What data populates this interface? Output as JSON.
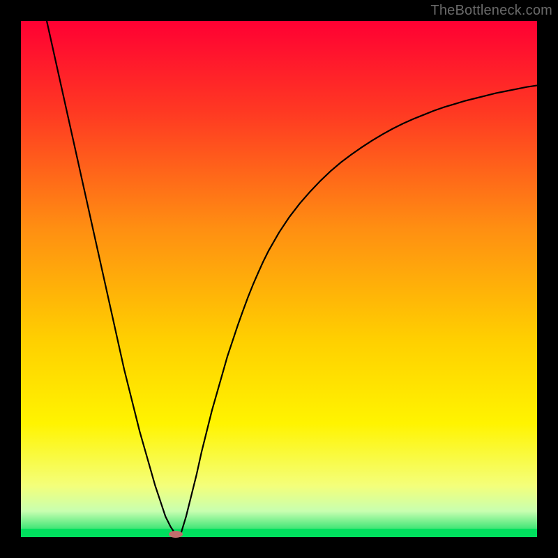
{
  "watermark": "TheBottleneck.com",
  "chart_data": {
    "type": "line",
    "title": "",
    "xlabel": "",
    "ylabel": "",
    "xlim": [
      0,
      100
    ],
    "ylim": [
      0,
      100
    ],
    "x": [
      5,
      6,
      7,
      8,
      9,
      10,
      11,
      12,
      13,
      14,
      15,
      16,
      17,
      18,
      19,
      20,
      21,
      22,
      23,
      24,
      25,
      26,
      27,
      28,
      29,
      30,
      31,
      32,
      33,
      34,
      35,
      36,
      37,
      38,
      39,
      40,
      41,
      42,
      43,
      44,
      45,
      46,
      47,
      48,
      50,
      52,
      54,
      56,
      58,
      60,
      62,
      64,
      66,
      68,
      70,
      72,
      74,
      76,
      78,
      80,
      82,
      84,
      86,
      88,
      90,
      92,
      94,
      96,
      98,
      100
    ],
    "values": [
      100,
      95.5,
      91,
      86.5,
      82,
      77.5,
      73,
      68.5,
      64,
      59.5,
      55,
      50.5,
      46,
      41.5,
      37,
      32.5,
      28.5,
      24.5,
      20.5,
      17,
      13.5,
      10,
      7,
      4,
      2,
      0.5,
      0.7,
      4,
      8,
      12,
      16.5,
      20.5,
      24.5,
      28,
      31.5,
      35,
      38,
      41,
      43.8,
      46.5,
      49,
      51.3,
      53.5,
      55.5,
      59,
      62,
      64.6,
      66.9,
      69,
      70.9,
      72.6,
      74.1,
      75.5,
      76.8,
      78,
      79.1,
      80.1,
      81,
      81.8,
      82.6,
      83.3,
      83.9,
      84.5,
      85,
      85.5,
      86,
      86.4,
      86.8,
      87.2,
      87.5
    ],
    "background_gradient": {
      "top": "#ff0033",
      "middle": "#ffdc00",
      "bottom_band": "#00d95b"
    },
    "minimum_marker_x": 30,
    "minimum_marker_color": "#c26d6d",
    "frame_color": "#000000"
  }
}
